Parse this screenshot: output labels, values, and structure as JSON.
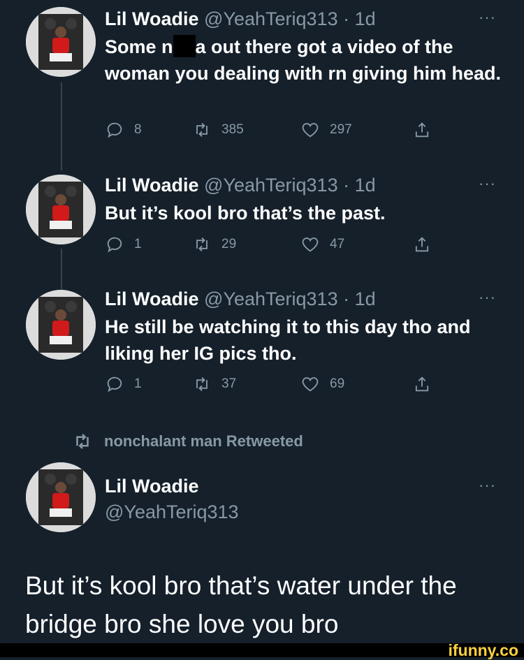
{
  "tweets": [
    {
      "name": "Lil Woadie",
      "handle": "@YeahTeriq313",
      "separator": "·",
      "time": "1d",
      "more": "···",
      "text_before": "Some n",
      "text_after": "a out there got a video of the woman you dealing with rn giving him head.",
      "replies": "8",
      "retweets": "385",
      "likes": "297"
    },
    {
      "name": "Lil Woadie",
      "handle": "@YeahTeriq313",
      "separator": "·",
      "time": "1d",
      "more": "···",
      "text": "But it’s kool bro that’s the past.",
      "replies": "1",
      "retweets": "29",
      "likes": "47"
    },
    {
      "name": "Lil Woadie",
      "handle": "@YeahTeriq313",
      "separator": "·",
      "time": "1d",
      "more": "···",
      "text": "He still be watching it to this day tho and liking her IG pics tho.",
      "replies": "1",
      "retweets": "37",
      "likes": "69"
    }
  ],
  "retweet_context": "nonchalant man Retweeted",
  "main_tweet": {
    "name": "Lil Woadie",
    "handle": "@YeahTeriq313",
    "more": "···",
    "text": "But it’s kool bro that’s water under the bridge bro she love you bro"
  },
  "watermark": "ifunny.co",
  "colors": {
    "background": "#15202b",
    "muted": "#8899a6",
    "thread_line": "#38444d",
    "watermark": "#fdd13c"
  },
  "icons": [
    "reply-icon",
    "retweet-icon",
    "like-icon",
    "share-icon",
    "more-icon",
    "avatar-image"
  ]
}
